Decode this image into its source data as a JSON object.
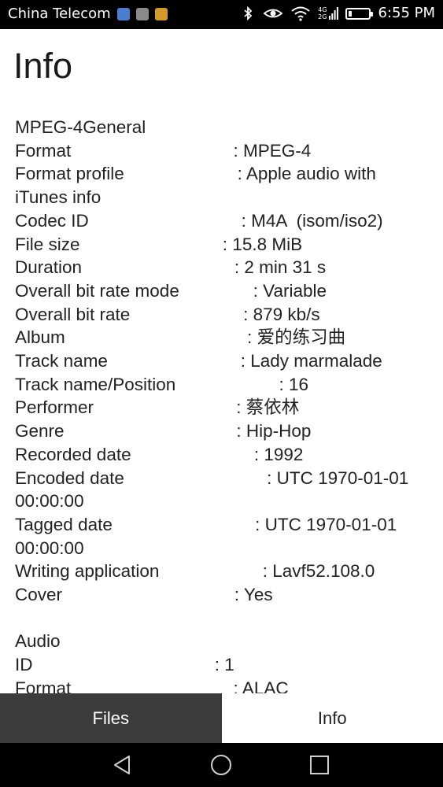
{
  "status_bar": {
    "carrier": "China Telecom",
    "time": "6:55 PM",
    "network_top": "4G",
    "network_bottom": "2G",
    "battery_level": 0.15,
    "icons": [
      "bluetooth-icon",
      "eye-icon",
      "wifi-icon",
      "signal-icon",
      "battery-icon"
    ]
  },
  "page": {
    "title": "Info",
    "info_text": "MPEG-4General\nFormat                                 : MPEG-4\nFormat profile                       : Apple audio with iTunes info\nCodec ID                               : M4A  (isom/iso2)\nFile size                             : 15.8 MiB\nDuration                               : 2 min 31 s\nOverall bit rate mode               : Variable\nOverall bit rate                       : 879 kb/s\nAlbum                                     : 爱的练习曲\nTrack name                           : Lady marmalade\nTrack name/Position                     : 16\nPerformer                             : 蔡依林\nGenre                                   : Hip-Hop\nRecorded date                         : 1992\nEncoded date                             : UTC 1970-01-01 00:00:00\nTagged date                             : UTC 1970-01-01 00:00:00\nWriting application                     : Lavf52.108.0\nCover                                   : Yes\n\nAudio\nID                                     : 1\nFormat                                 : ALAC"
  },
  "tabs": [
    {
      "label": "Files",
      "active": false
    },
    {
      "label": "Info",
      "active": true
    }
  ],
  "nav": [
    "back-icon",
    "home-icon",
    "recents-icon"
  ],
  "colors": {
    "status_bar": "#000000",
    "tab_inactive": "#3b3b3b",
    "tab_active": "#ffffff",
    "text": "#222222"
  }
}
